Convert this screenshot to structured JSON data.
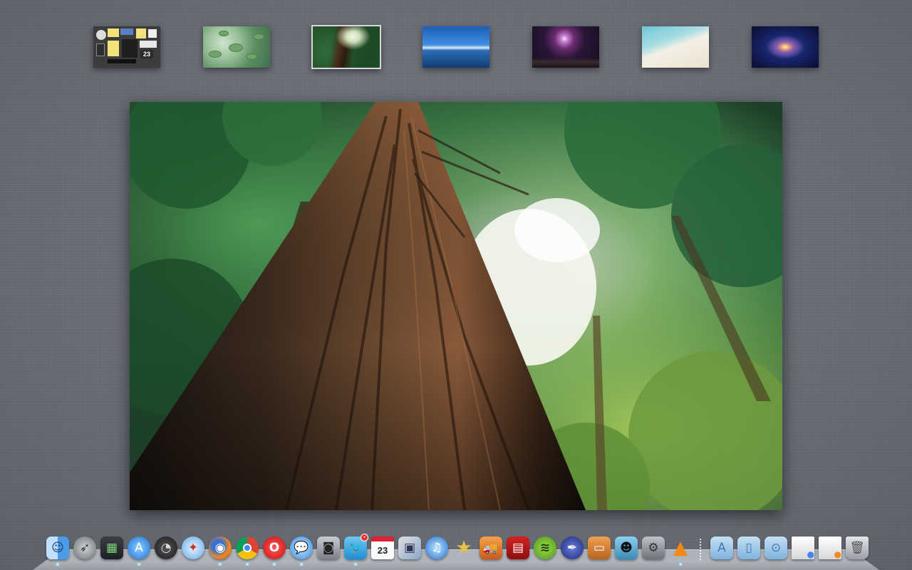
{
  "spaces": {
    "selected_index": 2,
    "items": [
      {
        "name": "Dashboard",
        "calendar_day": "23"
      },
      {
        "name": "Lily pads"
      },
      {
        "name": "Redwood forest"
      },
      {
        "name": "Mountain lake"
      },
      {
        "name": "Fireworks"
      },
      {
        "name": "Beach"
      },
      {
        "name": "Andromeda galaxy"
      }
    ]
  },
  "preview": {
    "subject": "Redwood tree looking up"
  },
  "dock": {
    "calendar_day": "23",
    "apps": [
      {
        "id": "finder",
        "icon": "finder-icon",
        "running": true
      },
      {
        "id": "launchpad",
        "icon": "rocket-icon",
        "running": false
      },
      {
        "id": "mission-control",
        "icon": "mission-control-icon",
        "running": false
      },
      {
        "id": "app-store",
        "icon": "app-store-icon",
        "running": true
      },
      {
        "id": "dashboard",
        "icon": "dashboard-icon",
        "running": false
      },
      {
        "id": "safari",
        "icon": "compass-icon",
        "running": false
      },
      {
        "id": "firefox",
        "icon": "firefox-icon",
        "running": true
      },
      {
        "id": "chrome",
        "icon": "chrome-icon",
        "running": true
      },
      {
        "id": "opera",
        "icon": "opera-icon",
        "running": true
      },
      {
        "id": "messages",
        "icon": "speech-bubble-icon",
        "running": true
      },
      {
        "id": "facetime",
        "icon": "video-camera-icon",
        "running": false
      },
      {
        "id": "twitter",
        "icon": "bird-icon",
        "running": true,
        "badge": true
      },
      {
        "id": "calendar",
        "icon": "calendar-icon",
        "running": false
      },
      {
        "id": "preview",
        "icon": "preview-icon",
        "running": false
      },
      {
        "id": "itunes",
        "icon": "music-note-icon",
        "running": false
      },
      {
        "id": "imovie",
        "icon": "star-icon",
        "running": false
      },
      {
        "id": "transmit",
        "icon": "truck-icon",
        "running": false
      },
      {
        "id": "photo-booth",
        "icon": "photo-booth-icon",
        "running": false
      },
      {
        "id": "spotify",
        "icon": "spotify-icon",
        "running": false
      },
      {
        "id": "quill",
        "icon": "quill-icon",
        "running": false
      },
      {
        "id": "keynote",
        "icon": "presentation-icon",
        "running": false
      },
      {
        "id": "ninja",
        "icon": "ninja-icon",
        "running": false
      },
      {
        "id": "system-preferences",
        "icon": "gear-icon",
        "running": false
      },
      {
        "id": "vlc",
        "icon": "traffic-cone-icon",
        "running": true
      }
    ],
    "stacks": [
      {
        "id": "applications",
        "icon": "applications-folder-icon"
      },
      {
        "id": "documents",
        "icon": "documents-folder-icon"
      },
      {
        "id": "downloads",
        "icon": "downloads-folder-icon"
      },
      {
        "id": "window-chrome",
        "icon": "minimized-window-icon"
      },
      {
        "id": "window-firefox",
        "icon": "minimized-window-icon"
      },
      {
        "id": "trash",
        "icon": "trash-icon"
      }
    ]
  }
}
